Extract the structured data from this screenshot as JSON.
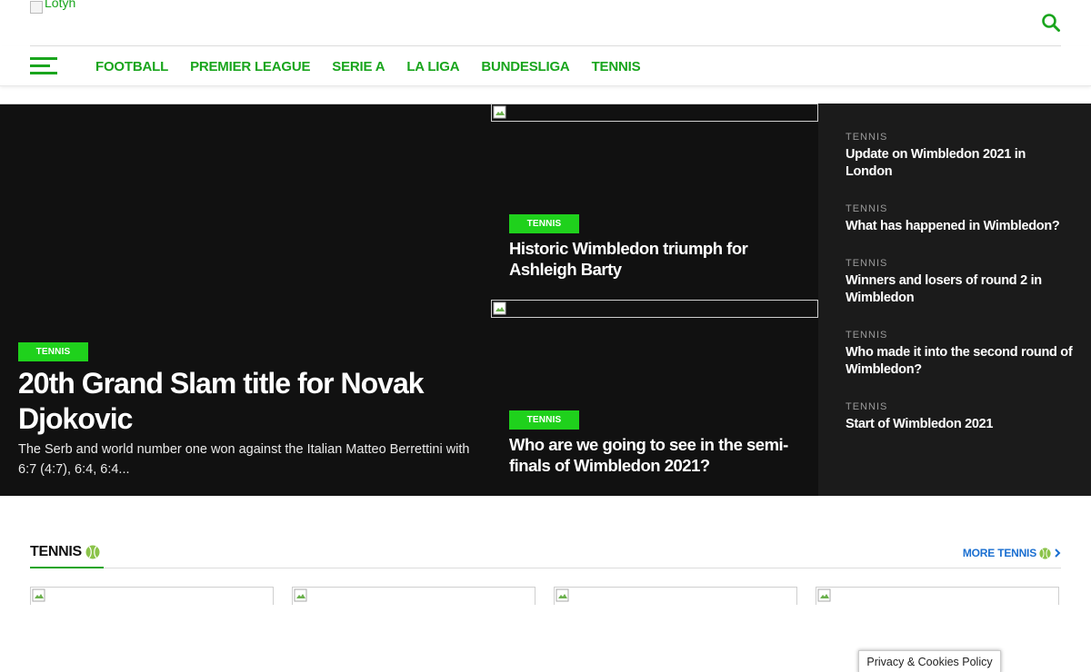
{
  "header": {
    "logo_alt": "Lotyh",
    "search_icon": "search-icon"
  },
  "nav": {
    "menu_icon": "hamburger-icon",
    "items": [
      {
        "label": "FOOTBALL"
      },
      {
        "label": "PREMIER LEAGUE"
      },
      {
        "label": "SERIE A"
      },
      {
        "label": "LA LIGA"
      },
      {
        "label": "BUNDESLIGA"
      },
      {
        "label": "TENNIS"
      }
    ]
  },
  "hero": {
    "main": {
      "tag": "TENNIS",
      "title": "20th Grand Slam title for Novak Djokovic",
      "excerpt": "The Serb and world number one won against the Italian Matteo Berrettini with 6:7 (4:7), 6:4, 6:4..."
    },
    "small": [
      {
        "tag": "TENNIS",
        "title": "Historic Wimbledon triumph for Ashleigh Barty"
      },
      {
        "tag": "TENNIS",
        "title": "Who are we going to see in the semi-finals of Wimbledon 2021?"
      }
    ],
    "sidebar": [
      {
        "category": "TENNIS",
        "title": "Update on Wimbledon 2021 in London"
      },
      {
        "category": "TENNIS",
        "title": "What has happened in Wimbledon?"
      },
      {
        "category": "TENNIS",
        "title": "Winners and losers of round 2 in Wimbledon"
      },
      {
        "category": "TENNIS",
        "title": "Who made it into the second round of Wimbledon?"
      },
      {
        "category": "TENNIS",
        "title": "Start of Wimbledon 2021"
      }
    ]
  },
  "section": {
    "title": "TENNIS",
    "more_label": "MORE TENNIS",
    "icon": "tennis-ball-icon"
  },
  "cookie": {
    "label": "Privacy & Cookies Policy"
  },
  "colors": {
    "accent": "#19a51d",
    "tag_bg": "#1fd11c",
    "dark_bg": "#111111",
    "sidebar_bg": "#1b1b1b",
    "link_blue": "#1a6fd1"
  }
}
